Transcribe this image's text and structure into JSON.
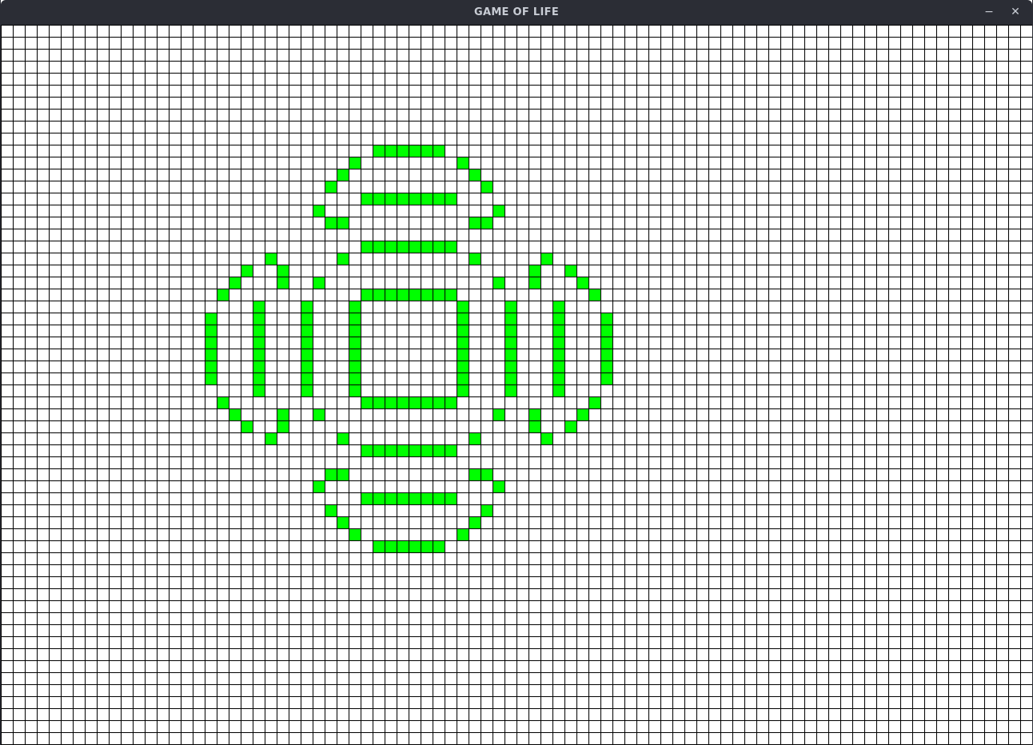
{
  "window": {
    "title": "GAME OF LIFE",
    "minimize_glyph": "−",
    "close_glyph": "✕"
  },
  "colors": {
    "titlebar": "#2b2d35",
    "title_text": "#c8ccd4",
    "grid_line": "#000000",
    "dead_cell": "#ffffff",
    "live_cell": "#00ff00"
  },
  "board": {
    "cell_size_label": "15px grid",
    "live_cells": [
      [
        10,
        31
      ],
      [
        10,
        32
      ],
      [
        10,
        33
      ],
      [
        10,
        34
      ],
      [
        10,
        35
      ],
      [
        10,
        36
      ],
      [
        11,
        29
      ],
      [
        11,
        38
      ],
      [
        12,
        28
      ],
      [
        12,
        39
      ],
      [
        13,
        27
      ],
      [
        13,
        40
      ],
      [
        14,
        30
      ],
      [
        14,
        31
      ],
      [
        14,
        32
      ],
      [
        14,
        33
      ],
      [
        14,
        34
      ],
      [
        14,
        35
      ],
      [
        14,
        36
      ],
      [
        14,
        37
      ],
      [
        15,
        26
      ],
      [
        15,
        41
      ],
      [
        16,
        27
      ],
      [
        16,
        28
      ],
      [
        16,
        39
      ],
      [
        16,
        40
      ],
      [
        18,
        30
      ],
      [
        18,
        31
      ],
      [
        18,
        32
      ],
      [
        18,
        33
      ],
      [
        18,
        34
      ],
      [
        18,
        35
      ],
      [
        18,
        36
      ],
      [
        18,
        37
      ],
      [
        19,
        22
      ],
      [
        19,
        28
      ],
      [
        19,
        39
      ],
      [
        19,
        45
      ],
      [
        20,
        20
      ],
      [
        20,
        23
      ],
      [
        20,
        44
      ],
      [
        20,
        47
      ],
      [
        21,
        19
      ],
      [
        21,
        23
      ],
      [
        21,
        26
      ],
      [
        21,
        41
      ],
      [
        21,
        44
      ],
      [
        21,
        48
      ],
      [
        22,
        18
      ],
      [
        22,
        30
      ],
      [
        22,
        31
      ],
      [
        22,
        32
      ],
      [
        22,
        33
      ],
      [
        22,
        34
      ],
      [
        22,
        35
      ],
      [
        22,
        36
      ],
      [
        22,
        37
      ],
      [
        22,
        49
      ],
      [
        23,
        21
      ],
      [
        23,
        25
      ],
      [
        23,
        29
      ],
      [
        23,
        38
      ],
      [
        23,
        42
      ],
      [
        23,
        46
      ],
      [
        24,
        17
      ],
      [
        24,
        21
      ],
      [
        24,
        25
      ],
      [
        24,
        29
      ],
      [
        24,
        38
      ],
      [
        24,
        42
      ],
      [
        24,
        46
      ],
      [
        24,
        50
      ],
      [
        25,
        17
      ],
      [
        25,
        21
      ],
      [
        25,
        25
      ],
      [
        25,
        29
      ],
      [
        25,
        38
      ],
      [
        25,
        42
      ],
      [
        25,
        46
      ],
      [
        25,
        50
      ],
      [
        26,
        17
      ],
      [
        26,
        21
      ],
      [
        26,
        25
      ],
      [
        26,
        29
      ],
      [
        26,
        38
      ],
      [
        26,
        42
      ],
      [
        26,
        46
      ],
      [
        26,
        50
      ],
      [
        27,
        17
      ],
      [
        27,
        21
      ],
      [
        27,
        25
      ],
      [
        27,
        29
      ],
      [
        27,
        38
      ],
      [
        27,
        42
      ],
      [
        27,
        46
      ],
      [
        27,
        50
      ],
      [
        28,
        17
      ],
      [
        28,
        21
      ],
      [
        28,
        25
      ],
      [
        28,
        29
      ],
      [
        28,
        38
      ],
      [
        28,
        42
      ],
      [
        28,
        46
      ],
      [
        28,
        50
      ],
      [
        29,
        17
      ],
      [
        29,
        21
      ],
      [
        29,
        25
      ],
      [
        29,
        29
      ],
      [
        29,
        38
      ],
      [
        29,
        42
      ],
      [
        29,
        46
      ],
      [
        29,
        50
      ],
      [
        30,
        21
      ],
      [
        30,
        25
      ],
      [
        30,
        29
      ],
      [
        30,
        38
      ],
      [
        30,
        42
      ],
      [
        30,
        46
      ],
      [
        31,
        18
      ],
      [
        31,
        30
      ],
      [
        31,
        31
      ],
      [
        31,
        32
      ],
      [
        31,
        33
      ],
      [
        31,
        34
      ],
      [
        31,
        35
      ],
      [
        31,
        36
      ],
      [
        31,
        37
      ],
      [
        31,
        49
      ],
      [
        32,
        19
      ],
      [
        32,
        23
      ],
      [
        32,
        26
      ],
      [
        32,
        41
      ],
      [
        32,
        44
      ],
      [
        32,
        48
      ],
      [
        33,
        20
      ],
      [
        33,
        23
      ],
      [
        33,
        44
      ],
      [
        33,
        47
      ],
      [
        34,
        22
      ],
      [
        34,
        28
      ],
      [
        34,
        39
      ],
      [
        34,
        45
      ],
      [
        35,
        30
      ],
      [
        35,
        31
      ],
      [
        35,
        32
      ],
      [
        35,
        33
      ],
      [
        35,
        34
      ],
      [
        35,
        35
      ],
      [
        35,
        36
      ],
      [
        35,
        37
      ],
      [
        37,
        27
      ],
      [
        37,
        28
      ],
      [
        37,
        39
      ],
      [
        37,
        40
      ],
      [
        38,
        26
      ],
      [
        38,
        41
      ],
      [
        39,
        30
      ],
      [
        39,
        31
      ],
      [
        39,
        32
      ],
      [
        39,
        33
      ],
      [
        39,
        34
      ],
      [
        39,
        35
      ],
      [
        39,
        36
      ],
      [
        39,
        37
      ],
      [
        40,
        27
      ],
      [
        40,
        40
      ],
      [
        41,
        28
      ],
      [
        41,
        39
      ],
      [
        42,
        29
      ],
      [
        42,
        38
      ],
      [
        43,
        31
      ],
      [
        43,
        32
      ],
      [
        43,
        33
      ],
      [
        43,
        34
      ],
      [
        43,
        35
      ],
      [
        43,
        36
      ]
    ]
  }
}
